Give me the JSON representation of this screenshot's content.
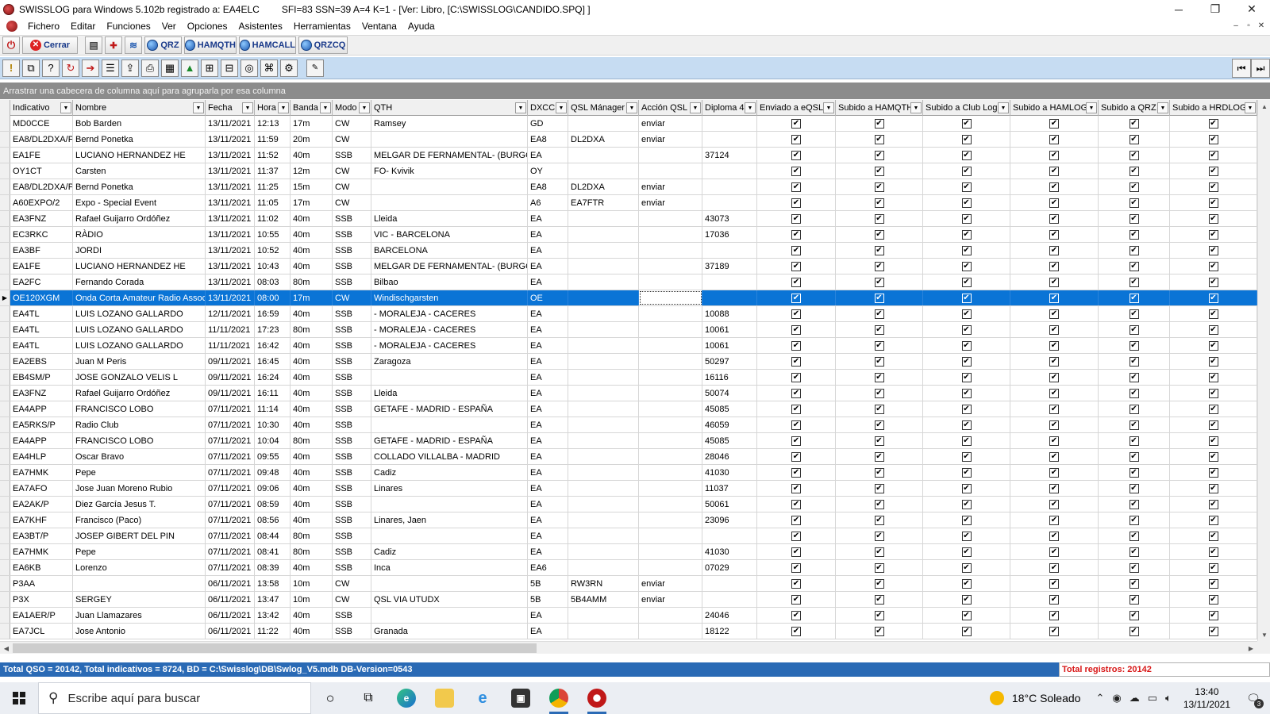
{
  "window": {
    "title": "SWISSLOG para Windows 5.102b registrado a: EA4ELC",
    "title_ext": "SFI=83 SSN=39 A=4 K=1 - [Ver: Libro, [C:\\SWISSLOG\\CANDIDO.SPQ] ]",
    "minimize": "─",
    "restore": "❐",
    "close": "✕"
  },
  "menu": [
    "Fichero",
    "Editar",
    "Funciones",
    "Ver",
    "Opciones",
    "Asistentes",
    "Herramientas",
    "Ventana",
    "Ayuda"
  ],
  "mdi": {
    "min": "–",
    "restore": "▫",
    "close": "✕"
  },
  "toolbar1": {
    "cerrar": "Cerrar",
    "qrz": "QRZ",
    "hamqth": "HAMQTH",
    "hamcall": "HAMCALL",
    "qrzcq": "QRZCQ"
  },
  "group_panel": "Arrastrar una cabecera de columna aquí para agruparla por esa columna",
  "columns": [
    {
      "label": "Indicativo",
      "width": 79
    },
    {
      "label": "Nombre",
      "width": 167
    },
    {
      "label": "Fecha",
      "width": 62
    },
    {
      "label": "Hora",
      "width": 45
    },
    {
      "label": "Banda",
      "width": 53
    },
    {
      "label": "Modo",
      "width": 49
    },
    {
      "label": "QTH",
      "width": 197
    },
    {
      "label": "DXCC",
      "width": 51
    },
    {
      "label": "QSL Mánager",
      "width": 89
    },
    {
      "label": "Acción QSL",
      "width": 80
    },
    {
      "label": "Diploma 4",
      "width": 69
    },
    {
      "label": "Enviado a eQSL",
      "width": 99
    },
    {
      "label": "Subido a HAMQTH",
      "width": 110
    },
    {
      "label": "Subido a Club Log",
      "width": 110
    },
    {
      "label": "Subido a HAMLOG",
      "width": 111
    },
    {
      "label": "Subido a QRZ",
      "width": 90
    },
    {
      "label": "Subido a HRDLOG",
      "width": 110
    }
  ],
  "rows": [
    [
      "MD0CCE",
      "Bob Barden",
      "13/11/2021",
      "12:13",
      "17m",
      "CW",
      "Ramsey",
      "GD",
      "",
      "enviar",
      ""
    ],
    [
      "EA8/DL2DXA/P",
      "Bernd Ponetka",
      "13/11/2021",
      "11:59",
      "20m",
      "CW",
      "",
      "EA8",
      "DL2DXA",
      "enviar",
      ""
    ],
    [
      "EA1FE",
      "LUCIANO HERNANDEZ HE",
      "13/11/2021",
      "11:52",
      "40m",
      "SSB",
      "MELGAR DE FERNAMENTAL- (BURGOS",
      "EA",
      "",
      "",
      "37124"
    ],
    [
      "OY1CT",
      "Carsten",
      "13/11/2021",
      "11:37",
      "12m",
      "CW",
      "FO- Kvivik",
      "OY",
      "",
      "",
      ""
    ],
    [
      "EA8/DL2DXA/P",
      "Bernd Ponetka",
      "13/11/2021",
      "11:25",
      "15m",
      "CW",
      "",
      "EA8",
      "DL2DXA",
      "enviar",
      ""
    ],
    [
      "A60EXPO/2",
      "Expo - Special Event",
      "13/11/2021",
      "11:05",
      "17m",
      "CW",
      "",
      "A6",
      "EA7FTR",
      "enviar",
      ""
    ],
    [
      "EA3FNZ",
      "Rafael Guijarro Ordóñez",
      "13/11/2021",
      "11:02",
      "40m",
      "SSB",
      "Lleida",
      "EA",
      "",
      "",
      "43073"
    ],
    [
      "EC3RKC",
      "RÀDIO",
      "13/11/2021",
      "10:55",
      "40m",
      "SSB",
      "VIC - BARCELONA",
      "EA",
      "",
      "",
      "17036"
    ],
    [
      "EA3BF",
      "JORDI",
      "13/11/2021",
      "10:52",
      "40m",
      "SSB",
      "BARCELONA",
      "EA",
      "",
      "",
      ""
    ],
    [
      "EA1FE",
      "LUCIANO HERNANDEZ HE",
      "13/11/2021",
      "10:43",
      "40m",
      "SSB",
      "MELGAR DE FERNAMENTAL- (BURGOS",
      "EA",
      "",
      "",
      "37189"
    ],
    [
      "EA2FC",
      "Fernando Corada",
      "13/11/2021",
      "08:03",
      "80m",
      "SSB",
      "Bilbao",
      "EA",
      "",
      "",
      ""
    ],
    [
      "OE120XGM",
      "Onda Corta Amateur Radio Assoc",
      "13/11/2021",
      "08:00",
      "17m",
      "CW",
      "Windischgarsten",
      "OE",
      "",
      "",
      ""
    ],
    [
      "EA4TL",
      "LUIS LOZANO GALLARDO",
      "12/11/2021",
      "16:59",
      "40m",
      "SSB",
      "- MORALEJA - CACERES",
      "EA",
      "",
      "",
      "10088"
    ],
    [
      "EA4TL",
      "LUIS LOZANO GALLARDO",
      "11/11/2021",
      "17:23",
      "80m",
      "SSB",
      "- MORALEJA - CACERES",
      "EA",
      "",
      "",
      "10061"
    ],
    [
      "EA4TL",
      "LUIS LOZANO GALLARDO",
      "11/11/2021",
      "16:42",
      "40m",
      "SSB",
      "- MORALEJA - CACERES",
      "EA",
      "",
      "",
      "10061"
    ],
    [
      "EA2EBS",
      "Juan M Peris",
      "09/11/2021",
      "16:45",
      "40m",
      "SSB",
      "Zaragoza",
      "EA",
      "",
      "",
      "50297"
    ],
    [
      "EB4SM/P",
      "JOSE GONZALO VELIS L",
      "09/11/2021",
      "16:24",
      "40m",
      "SSB",
      "",
      "EA",
      "",
      "",
      "16116"
    ],
    [
      "EA3FNZ",
      "Rafael Guijarro Ordóñez",
      "09/11/2021",
      "16:11",
      "40m",
      "SSB",
      "Lleida",
      "EA",
      "",
      "",
      "50074"
    ],
    [
      "EA4APP",
      "FRANCISCO LOBO",
      "07/11/2021",
      "11:14",
      "40m",
      "SSB",
      "GETAFE - MADRID - ESPAÑA",
      "EA",
      "",
      "",
      "45085"
    ],
    [
      "EA5RKS/P",
      "Radio Club",
      "07/11/2021",
      "10:30",
      "40m",
      "SSB",
      "",
      "EA",
      "",
      "",
      "46059"
    ],
    [
      "EA4APP",
      "FRANCISCO LOBO",
      "07/11/2021",
      "10:04",
      "80m",
      "SSB",
      "GETAFE - MADRID - ESPAÑA",
      "EA",
      "",
      "",
      "45085"
    ],
    [
      "EA4HLP",
      "Oscar Bravo",
      "07/11/2021",
      "09:55",
      "40m",
      "SSB",
      "COLLADO VILLALBA - MADRID",
      "EA",
      "",
      "",
      "28046"
    ],
    [
      "EA7HMK",
      "Pepe",
      "07/11/2021",
      "09:48",
      "40m",
      "SSB",
      "Cadiz",
      "EA",
      "",
      "",
      "41030"
    ],
    [
      "EA7AFO",
      "Jose Juan Moreno Rubio",
      "07/11/2021",
      "09:06",
      "40m",
      "SSB",
      "Linares",
      "EA",
      "",
      "",
      "11037"
    ],
    [
      "EA2AK/P",
      "Diez García Jesus T.",
      "07/11/2021",
      "08:59",
      "40m",
      "SSB",
      "",
      "EA",
      "",
      "",
      "50061"
    ],
    [
      "EA7KHF",
      "Francisco (Paco)",
      "07/11/2021",
      "08:56",
      "40m",
      "SSB",
      "Linares, Jaen",
      "EA",
      "",
      "",
      "23096"
    ],
    [
      "EA3BT/P",
      "JOSEP GIBERT DEL PIN",
      "07/11/2021",
      "08:44",
      "80m",
      "SSB",
      "",
      "EA",
      "",
      "",
      ""
    ],
    [
      "EA7HMK",
      "Pepe",
      "07/11/2021",
      "08:41",
      "80m",
      "SSB",
      "Cadiz",
      "EA",
      "",
      "",
      "41030"
    ],
    [
      "EA6KB",
      "Lorenzo",
      "07/11/2021",
      "08:39",
      "40m",
      "SSB",
      "Inca",
      "EA6",
      "",
      "",
      "07029"
    ],
    [
      "P3AA",
      "",
      "06/11/2021",
      "13:58",
      "10m",
      "CW",
      "",
      "5B",
      "RW3RN",
      "enviar",
      ""
    ],
    [
      "P3X",
      "SERGEY",
      "06/11/2021",
      "13:47",
      "10m",
      "CW",
      "QSL VIA UTUDX",
      "5B",
      "5B4AMM",
      "enviar",
      ""
    ],
    [
      "EA1AER/P",
      "Juan Llamazares",
      "06/11/2021",
      "13:42",
      "40m",
      "SSB",
      "",
      "EA",
      "",
      "",
      "24046"
    ],
    [
      "EA7JCL",
      "Jose Antonio",
      "06/11/2021",
      "11:22",
      "40m",
      "SSB",
      "Granada",
      "EA",
      "",
      "",
      "18122"
    ]
  ],
  "selected_row": 11,
  "row_indicator": "▶",
  "check_mark": "✔",
  "dropdown_glyph": "▼",
  "status": {
    "left": "Total QSO = 20142, Total indicativos = 8724, BD = C:\\Swisslog\\DB\\Swlog_V5.mdb DB-Version=0543",
    "right": "Total registros: 20142"
  },
  "taskbar": {
    "search_placeholder": "Escribe aquí para buscar",
    "weather": "18°C  Soleado",
    "time": "13:40",
    "date": "13/11/2021",
    "notifications": "3"
  }
}
